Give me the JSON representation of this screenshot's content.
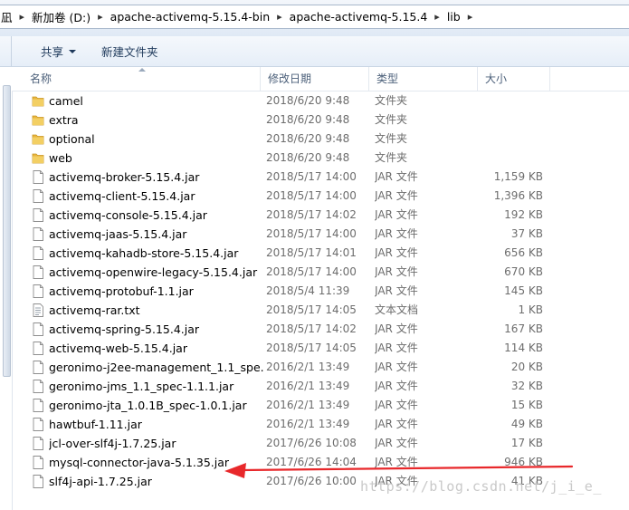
{
  "address": {
    "crumbs": [
      "凪",
      "新加卷 (D:)",
      "apache-activemq-5.15.4-bin",
      "apache-activemq-5.15.4",
      "lib"
    ]
  },
  "toolbar": {
    "share_label": "共享",
    "new_folder_label": "新建文件夹"
  },
  "columns": {
    "name": "名称",
    "modified": "修改日期",
    "type": "类型",
    "size": "大小"
  },
  "files": [
    {
      "icon": "folder-icon",
      "name": "camel",
      "date": "2018/6/20 9:48",
      "type": "文件夹",
      "size": ""
    },
    {
      "icon": "folder-icon",
      "name": "extra",
      "date": "2018/6/20 9:48",
      "type": "文件夹",
      "size": ""
    },
    {
      "icon": "folder-icon",
      "name": "optional",
      "date": "2018/6/20 9:48",
      "type": "文件夹",
      "size": ""
    },
    {
      "icon": "folder-icon",
      "name": "web",
      "date": "2018/6/20 9:48",
      "type": "文件夹",
      "size": ""
    },
    {
      "icon": "file-icon",
      "name": "activemq-broker-5.15.4.jar",
      "date": "2018/5/17 14:00",
      "type": "JAR 文件",
      "size": "1,159 KB"
    },
    {
      "icon": "file-icon",
      "name": "activemq-client-5.15.4.jar",
      "date": "2018/5/17 14:00",
      "type": "JAR 文件",
      "size": "1,396 KB"
    },
    {
      "icon": "file-icon",
      "name": "activemq-console-5.15.4.jar",
      "date": "2018/5/17 14:02",
      "type": "JAR 文件",
      "size": "192 KB"
    },
    {
      "icon": "file-icon",
      "name": "activemq-jaas-5.15.4.jar",
      "date": "2018/5/17 14:00",
      "type": "JAR 文件",
      "size": "37 KB"
    },
    {
      "icon": "file-icon",
      "name": "activemq-kahadb-store-5.15.4.jar",
      "date": "2018/5/17 14:01",
      "type": "JAR 文件",
      "size": "656 KB"
    },
    {
      "icon": "file-icon",
      "name": "activemq-openwire-legacy-5.15.4.jar",
      "date": "2018/5/17 14:00",
      "type": "JAR 文件",
      "size": "670 KB"
    },
    {
      "icon": "file-icon",
      "name": "activemq-protobuf-1.1.jar",
      "date": "2018/5/4 11:39",
      "type": "JAR 文件",
      "size": "145 KB"
    },
    {
      "icon": "text-file-icon",
      "name": "activemq-rar.txt",
      "date": "2018/5/17 14:05",
      "type": "文本文档",
      "size": "1 KB"
    },
    {
      "icon": "file-icon",
      "name": "activemq-spring-5.15.4.jar",
      "date": "2018/5/17 14:02",
      "type": "JAR 文件",
      "size": "167 KB"
    },
    {
      "icon": "file-icon",
      "name": "activemq-web-5.15.4.jar",
      "date": "2018/5/17 14:05",
      "type": "JAR 文件",
      "size": "114 KB"
    },
    {
      "icon": "file-icon",
      "name": "geronimo-j2ee-management_1.1_spe...",
      "date": "2016/2/1 13:49",
      "type": "JAR 文件",
      "size": "20 KB"
    },
    {
      "icon": "file-icon",
      "name": "geronimo-jms_1.1_spec-1.1.1.jar",
      "date": "2016/2/1 13:49",
      "type": "JAR 文件",
      "size": "32 KB"
    },
    {
      "icon": "file-icon",
      "name": "geronimo-jta_1.0.1B_spec-1.0.1.jar",
      "date": "2016/2/1 13:49",
      "type": "JAR 文件",
      "size": "15 KB"
    },
    {
      "icon": "file-icon",
      "name": "hawtbuf-1.11.jar",
      "date": "2016/2/1 13:49",
      "type": "JAR 文件",
      "size": "49 KB"
    },
    {
      "icon": "file-icon",
      "name": "jcl-over-slf4j-1.7.25.jar",
      "date": "2017/6/26 10:08",
      "type": "JAR 文件",
      "size": "17 KB"
    },
    {
      "icon": "file-icon",
      "name": "mysql-connector-java-5.1.35.jar",
      "date": "2017/6/26 14:04",
      "type": "JAR 文件",
      "size": "946 KB"
    },
    {
      "icon": "file-icon",
      "name": "slf4j-api-1.7.25.jar",
      "date": "2017/6/26 10:00",
      "type": "JAR 文件",
      "size": "41 KB"
    }
  ],
  "watermark": "https://blog.csdn.net/j_i_e_",
  "colors": {
    "arrow": "#e8282b",
    "folder": "#e8b640"
  }
}
